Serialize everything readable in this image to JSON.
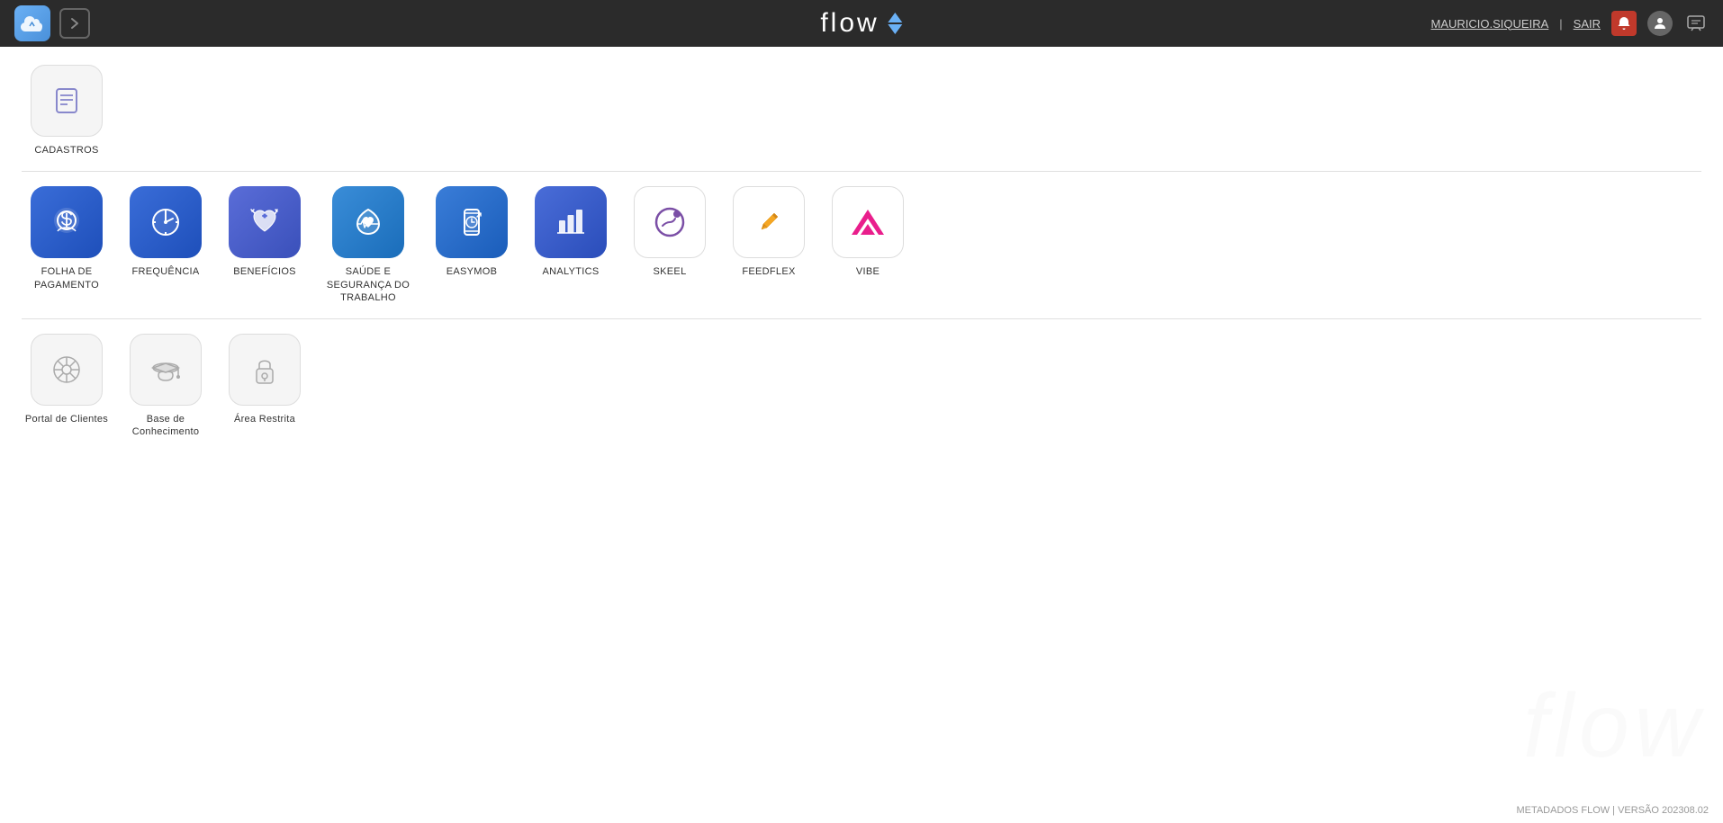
{
  "header": {
    "title": "flow",
    "user": "MAURICIO.SIQUEIRA",
    "separator": "|",
    "logout": "SAIR",
    "version_label": "METADADOS FLOW | VERSÃO 202308.02"
  },
  "sections": {
    "cadastros": {
      "label": "CADASTROS",
      "icon_type": "list"
    },
    "apps_section_label": "",
    "support_section_label": ""
  },
  "apps": [
    {
      "id": "folha-pagamento",
      "label": "FOLHA DE\nPAGAMENTO",
      "icon_class": "icon-folha",
      "icon_type": "coin"
    },
    {
      "id": "frequencia",
      "label": "FREQUÊNCIA",
      "icon_class": "icon-frequencia",
      "icon_type": "clock"
    },
    {
      "id": "beneficios",
      "label": "BENEFÍCIOS",
      "icon_class": "icon-beneficios",
      "icon_type": "heart"
    },
    {
      "id": "saude-seguranca",
      "label": "SAÚDE E\nSEGURANÇA DO\nTRABALHO",
      "icon_class": "icon-saude",
      "icon_type": "health"
    },
    {
      "id": "easymob",
      "label": "EASYMOB",
      "icon_class": "icon-easymob",
      "icon_type": "mobile"
    },
    {
      "id": "analytics",
      "label": "ANALYTICS",
      "icon_class": "icon-analytics",
      "icon_type": "bar-chart"
    },
    {
      "id": "skeel",
      "label": "SKEEL",
      "icon_class": "icon-skeel",
      "icon_type": "skeel"
    },
    {
      "id": "feedflex",
      "label": "FEEDFLEX",
      "icon_class": "icon-feedflex",
      "icon_type": "feedflex"
    },
    {
      "id": "vibe",
      "label": "VIBE",
      "icon_class": "icon-vibe",
      "icon_type": "vibe"
    }
  ],
  "support_apps": [
    {
      "id": "portal-clientes",
      "label": "Portal de Clientes",
      "icon_class": "icon-portal",
      "icon_type": "gear"
    },
    {
      "id": "base-conhecimento",
      "label": "Base de\nConhecimento",
      "icon_class": "icon-base",
      "icon_type": "graduation"
    },
    {
      "id": "area-restrita",
      "label": "Área Restrita",
      "icon_class": "icon-restrita",
      "icon_type": "lock"
    }
  ]
}
